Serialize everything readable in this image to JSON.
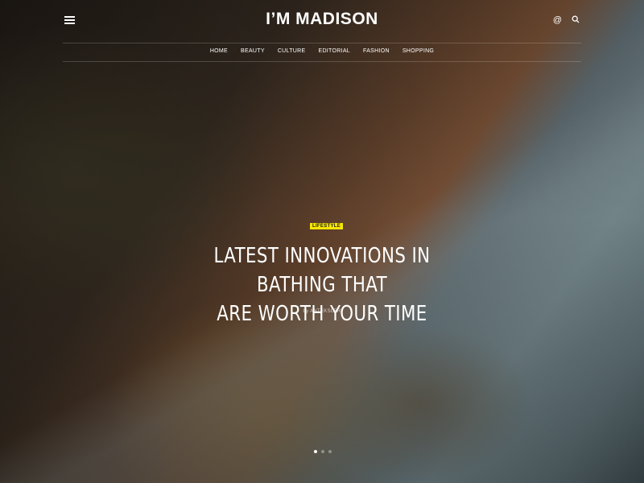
{
  "header": {
    "logo": "I’M MADISON",
    "icons": [
      "menu-icon",
      "at-icon",
      "search-icon"
    ],
    "at_symbol": "@"
  },
  "nav": {
    "items": [
      "HOME",
      "BEAUTY",
      "CULTURE",
      "EDITORIAL",
      "FASHION",
      "SHOPPING"
    ]
  },
  "hero": {
    "category": "LIFESTYLE",
    "title_line1": "LATEST INNOVATIONS IN BATHING THAT",
    "title_line2": "ARE WORTH YOUR TIME",
    "byline": "by ANTEKSLER",
    "accent_color": "#f6e500"
  },
  "slider": {
    "active_index": 0,
    "total": 3
  }
}
